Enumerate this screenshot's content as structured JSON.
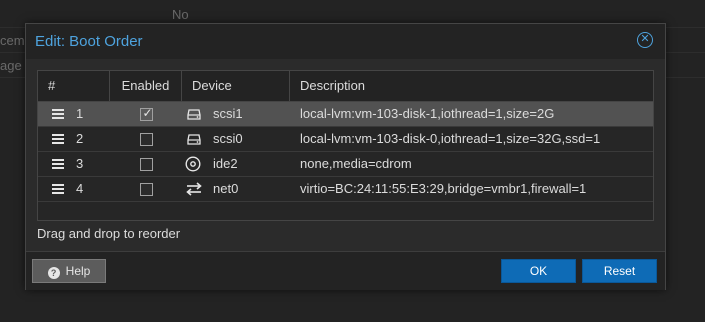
{
  "background": {
    "cell_value": "No",
    "row_label_1": "ceme",
    "row_label_2": "age"
  },
  "dialog": {
    "title": "Edit: Boot Order",
    "close_icon": "close-circle-icon",
    "columns": [
      "#",
      "Enabled",
      "Device",
      "Description"
    ],
    "rows": [
      {
        "index": "1",
        "enabled": true,
        "device": "scsi1",
        "device_icon": "hdd-icon",
        "description": "local-lvm:vm-103-disk-1,iothread=1,size=2G",
        "selected": true
      },
      {
        "index": "2",
        "enabled": false,
        "device": "scsi0",
        "device_icon": "hdd-icon",
        "description": "local-lvm:vm-103-disk-0,iothread=1,size=32G,ssd=1",
        "selected": false
      },
      {
        "index": "3",
        "enabled": false,
        "device": "ide2",
        "device_icon": "cdrom-icon",
        "description": "none,media=cdrom",
        "selected": false
      },
      {
        "index": "4",
        "enabled": false,
        "device": "net0",
        "device_icon": "exchange-icon",
        "description": "virtio=BC:24:11:55:E3:29,bridge=vmbr1,firewall=1",
        "selected": false
      }
    ],
    "note": "Drag and drop to reorder",
    "buttons": {
      "help": "Help",
      "ok": "OK",
      "reset": "Reset"
    }
  },
  "colors": {
    "accent": "#4ea3de",
    "primary_button": "#0e6bb6",
    "selected_row": "#525252"
  }
}
